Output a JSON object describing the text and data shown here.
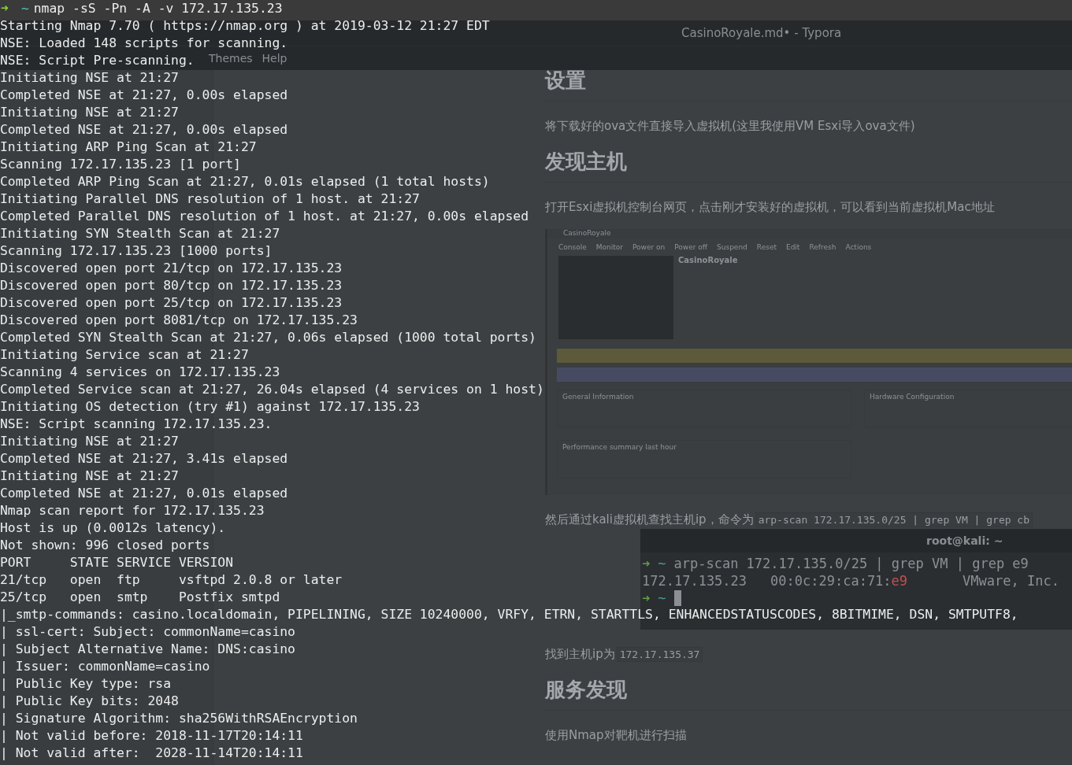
{
  "terminal": {
    "prompt": {
      "arrow": "➜",
      "dir": "~",
      "command": "nmap -sS -Pn -A -v 172.17.135.23"
    },
    "lines": [
      "Starting Nmap 7.70 ( https://nmap.org ) at 2019-03-12 21:27 EDT",
      "NSE: Loaded 148 scripts for scanning.",
      "NSE: Script Pre-scanning.",
      "Initiating NSE at 21:27",
      "Completed NSE at 21:27, 0.00s elapsed",
      "Initiating NSE at 21:27",
      "Completed NSE at 21:27, 0.00s elapsed",
      "Initiating ARP Ping Scan at 21:27",
      "Scanning 172.17.135.23 [1 port]",
      "Completed ARP Ping Scan at 21:27, 0.01s elapsed (1 total hosts)",
      "Initiating Parallel DNS resolution of 1 host. at 21:27",
      "Completed Parallel DNS resolution of 1 host. at 21:27, 0.00s elapsed",
      "Initiating SYN Stealth Scan at 21:27",
      "Scanning 172.17.135.23 [1000 ports]",
      "Discovered open port 21/tcp on 172.17.135.23",
      "Discovered open port 80/tcp on 172.17.135.23",
      "Discovered open port 25/tcp on 172.17.135.23",
      "Discovered open port 8081/tcp on 172.17.135.23",
      "Completed SYN Stealth Scan at 21:27, 0.06s elapsed (1000 total ports)",
      "Initiating Service scan at 21:27",
      "Scanning 4 services on 172.17.135.23",
      "Completed Service scan at 21:27, 26.04s elapsed (4 services on 1 host)",
      "Initiating OS detection (try #1) against 172.17.135.23",
      "NSE: Script scanning 172.17.135.23.",
      "Initiating NSE at 21:27",
      "Completed NSE at 21:27, 3.41s elapsed",
      "Initiating NSE at 21:27",
      "Completed NSE at 21:27, 0.01s elapsed",
      "Nmap scan report for 172.17.135.23",
      "Host is up (0.0012s latency).",
      "Not shown: 996 closed ports",
      "PORT     STATE SERVICE VERSION",
      "21/tcp   open  ftp     vsftpd 2.0.8 or later",
      "25/tcp   open  smtp    Postfix smtpd",
      "|_smtp-commands: casino.localdomain, PIPELINING, SIZE 10240000, VRFY, ETRN, STARTTLS, ENHANCEDSTATUSCODES, 8BITMIME, DSN, SMTPUTF8,",
      "| ssl-cert: Subject: commonName=casino",
      "| Subject Alternative Name: DNS:casino",
      "| Issuer: commonName=casino",
      "| Public Key type: rsa",
      "| Public Key bits: 2048",
      "| Signature Algorithm: sha256WithRSAEncryption",
      "| Not valid before: 2018-11-17T20:14:11",
      "| Not valid after:  2028-11-14T20:14:11"
    ]
  },
  "background_window": {
    "title": "CasinoRoyale.md• - Typora",
    "menu": [
      "Themes",
      "Help"
    ],
    "document": [
      {
        "kind": "heading",
        "text": "设置"
      },
      {
        "kind": "paragraph",
        "text": "将下载好的ova文件直接导入虚拟机(这里我使用VM Esxi导入ova文件)"
      },
      {
        "kind": "heading",
        "text": "发现主机"
      },
      {
        "kind": "paragraph",
        "text": "打开Esxi虚拟机控制台网页，点击刚才安装好的虚拟机，可以看到当前虚拟机Mac地址"
      },
      {
        "kind": "screenshot",
        "title": "CasinoRoyale",
        "toolbar": [
          "Console",
          "Monitor",
          "Power on",
          "Power off",
          "Suspend",
          "Reset",
          "Edit",
          "Refresh",
          "Actions"
        ],
        "vm_name": "CasinoRoyale",
        "sections": [
          "General Information",
          "Hardware Configuration",
          "Performance summary last hour"
        ]
      },
      {
        "kind": "paragraph",
        "text": "然后通过kali虚拟机查找主机ip，命令为",
        "code": "arp-scan 172.17.135.0/25 | grep VM | grep cb"
      },
      {
        "kind": "terminal_image",
        "title": "root@kali: ~",
        "command": {
          "arrow": "➜",
          "dir": "~",
          "text": "arp-scan 172.17.135.0/25 | grep VM | grep e9"
        },
        "result": {
          "ip": "172.17.135.23",
          "mac": "00:0c:29:ca:71:",
          "mac_highlight": "e9",
          "vendor": "VMware, Inc."
        },
        "prompt": {
          "arrow": "➜",
          "dir": "~"
        }
      },
      {
        "kind": "paragraph",
        "text": "找到主机ip为",
        "code": "172.17.135.37"
      },
      {
        "kind": "heading",
        "text": "服务发现"
      },
      {
        "kind": "paragraph",
        "text": "使用Nmap对靶机进行扫描"
      }
    ]
  }
}
